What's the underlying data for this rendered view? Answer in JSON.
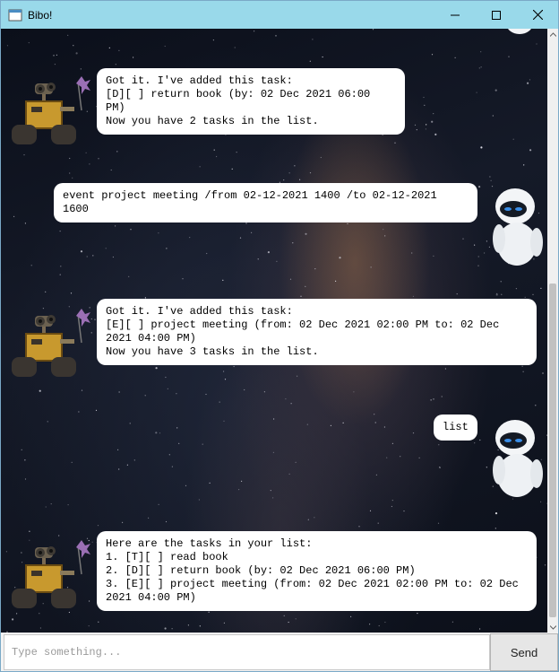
{
  "window": {
    "title": "Bibo!"
  },
  "icons": {
    "app": "app-icon",
    "minimize": "minimize-icon",
    "maximize": "maximize-icon",
    "close": "close-icon",
    "bot_avatar": "walle-robot-avatar",
    "user_avatar": "eve-robot-avatar"
  },
  "messages": [
    {
      "sender": "bot",
      "lines": [
        "Got it. I've added this task:",
        "[D][ ] return book (by: 02 Dec 2021 06:00 PM)",
        "Now you have 2 tasks in the list."
      ]
    },
    {
      "sender": "user",
      "lines": [
        "event project meeting /from 02-12-2021 1400 /to 02-12-2021 1600"
      ]
    },
    {
      "sender": "bot",
      "lines": [
        "Got it. I've added this task:",
        "[E][ ] project meeting (from: 02 Dec 2021 02:00 PM to: 02 Dec",
        "2021 04:00 PM)",
        "Now you have 3 tasks in the list."
      ]
    },
    {
      "sender": "user",
      "lines": [
        "list"
      ]
    },
    {
      "sender": "bot",
      "lines": [
        "Here are the tasks in your list:",
        "1. [T][ ] read book",
        "2. [D][ ] return book (by: 02 Dec 2021 06:00 PM)",
        "3. [E][ ] project meeting (from: 02 Dec 2021 02:00 PM to: 02 Dec",
        "2021 04:00 PM)"
      ]
    }
  ],
  "input": {
    "placeholder": "Type something...",
    "value": ""
  },
  "send_label": "Send"
}
